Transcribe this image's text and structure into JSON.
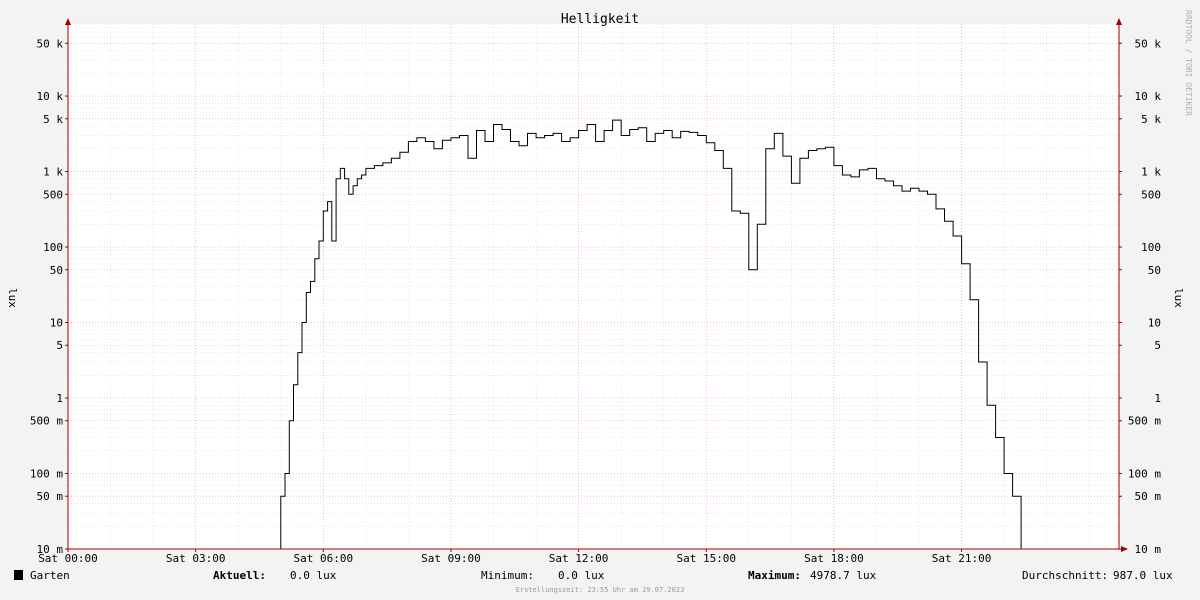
{
  "chart_data": {
    "type": "line",
    "title": "Helligkeit",
    "ylabel": "lux",
    "yscale": "log",
    "ylim": [
      0.01,
      90000
    ],
    "xlim": [
      0,
      24.7
    ],
    "y_ticks": [
      {
        "value": 0.01,
        "label": "10 m"
      },
      {
        "value": 0.05,
        "label": "50 m"
      },
      {
        "value": 0.1,
        "label": "100 m"
      },
      {
        "value": 0.5,
        "label": "500 m"
      },
      {
        "value": 1,
        "label": "1"
      },
      {
        "value": 5,
        "label": "5"
      },
      {
        "value": 10,
        "label": "10"
      },
      {
        "value": 50,
        "label": "50"
      },
      {
        "value": 100,
        "label": "100"
      },
      {
        "value": 500,
        "label": "500"
      },
      {
        "value": 1000,
        "label": "1 k"
      },
      {
        "value": 5000,
        "label": "5 k"
      },
      {
        "value": 10000,
        "label": "10 k"
      },
      {
        "value": 50000,
        "label": "50 k"
      }
    ],
    "x_ticks": [
      {
        "value": 0,
        "label": "Sat 00:00"
      },
      {
        "value": 3,
        "label": "Sat 03:00"
      },
      {
        "value": 6,
        "label": "Sat 06:00"
      },
      {
        "value": 9,
        "label": "Sat 09:00"
      },
      {
        "value": 12,
        "label": "Sat 12:00"
      },
      {
        "value": 15,
        "label": "Sat 15:00"
      },
      {
        "value": 18,
        "label": "Sat 18:00"
      },
      {
        "value": 21,
        "label": "Sat 21:00"
      }
    ],
    "grid": true,
    "series": [
      {
        "name": "Garten",
        "color": "#000000",
        "x": [
          0.0,
          5.0,
          5.1,
          5.2,
          5.3,
          5.4,
          5.5,
          5.6,
          5.7,
          5.8,
          5.9,
          6.0,
          6.1,
          6.2,
          6.3,
          6.4,
          6.5,
          6.6,
          6.7,
          6.8,
          6.9,
          7.0,
          7.2,
          7.4,
          7.6,
          7.8,
          8.0,
          8.2,
          8.4,
          8.6,
          8.8,
          9.0,
          9.2,
          9.4,
          9.6,
          9.8,
          10.0,
          10.2,
          10.4,
          10.6,
          10.8,
          11.0,
          11.2,
          11.4,
          11.6,
          11.8,
          12.0,
          12.2,
          12.4,
          12.6,
          12.8,
          13.0,
          13.2,
          13.4,
          13.6,
          13.8,
          14.0,
          14.2,
          14.4,
          14.6,
          14.8,
          15.0,
          15.2,
          15.4,
          15.6,
          15.8,
          16.0,
          16.2,
          16.4,
          16.6,
          16.8,
          17.0,
          17.2,
          17.4,
          17.6,
          17.8,
          18.0,
          18.2,
          18.4,
          18.6,
          18.8,
          19.0,
          19.2,
          19.4,
          19.6,
          19.8,
          20.0,
          20.2,
          20.4,
          20.6,
          20.8,
          21.0,
          21.2,
          21.4,
          21.6,
          21.8,
          22.0,
          22.2,
          22.4,
          22.6,
          22.8,
          23.0,
          24.7
        ],
        "y": [
          0.01,
          0.05,
          0.1,
          0.5,
          1.5,
          4,
          10,
          25,
          35,
          70,
          120,
          300,
          400,
          120,
          800,
          1100,
          800,
          500,
          650,
          800,
          900,
          1100,
          1200,
          1300,
          1500,
          1800,
          2500,
          2800,
          2500,
          2000,
          2600,
          2800,
          3000,
          1500,
          3500,
          2500,
          4200,
          3600,
          2500,
          2200,
          3200,
          2800,
          3000,
          3200,
          2500,
          2800,
          3500,
          4200,
          2500,
          3500,
          4800,
          3000,
          3600,
          3800,
          2500,
          3200,
          3500,
          2800,
          3400,
          3300,
          3000,
          2400,
          1900,
          1100,
          300,
          280,
          50,
          200,
          2000,
          3200,
          1600,
          700,
          1500,
          1900,
          2000,
          2100,
          1200,
          900,
          850,
          1050,
          1100,
          800,
          750,
          650,
          550,
          600,
          550,
          500,
          320,
          220,
          140,
          60,
          20,
          3,
          0.8,
          0.3,
          0.1,
          0.05,
          0.01,
          0.01,
          0.01,
          0.01,
          0.01
        ]
      }
    ]
  },
  "watermark": "RRDTOOL / TOBI OETIKER",
  "footer": {
    "legend_label": "Garten",
    "current_label": "Aktuell:",
    "current_value": "0.0 lux",
    "min_label": "Minimum:",
    "min_value": "0.0 lux",
    "max_label": "Maximum:",
    "max_value": "4978.7 lux",
    "avg_label": "Durchschnitt:",
    "avg_value": "987.0 lux",
    "created": "Erstellungszeit: 23:55 Uhr am 29.07.2023"
  },
  "colors": {
    "background": "#f3f3f3",
    "plot_bg": "#ffffff",
    "major_grid": "#e5a0a0",
    "minor_grid": "#d6d6d6",
    "axis": "#a00000",
    "line": "#000000"
  }
}
